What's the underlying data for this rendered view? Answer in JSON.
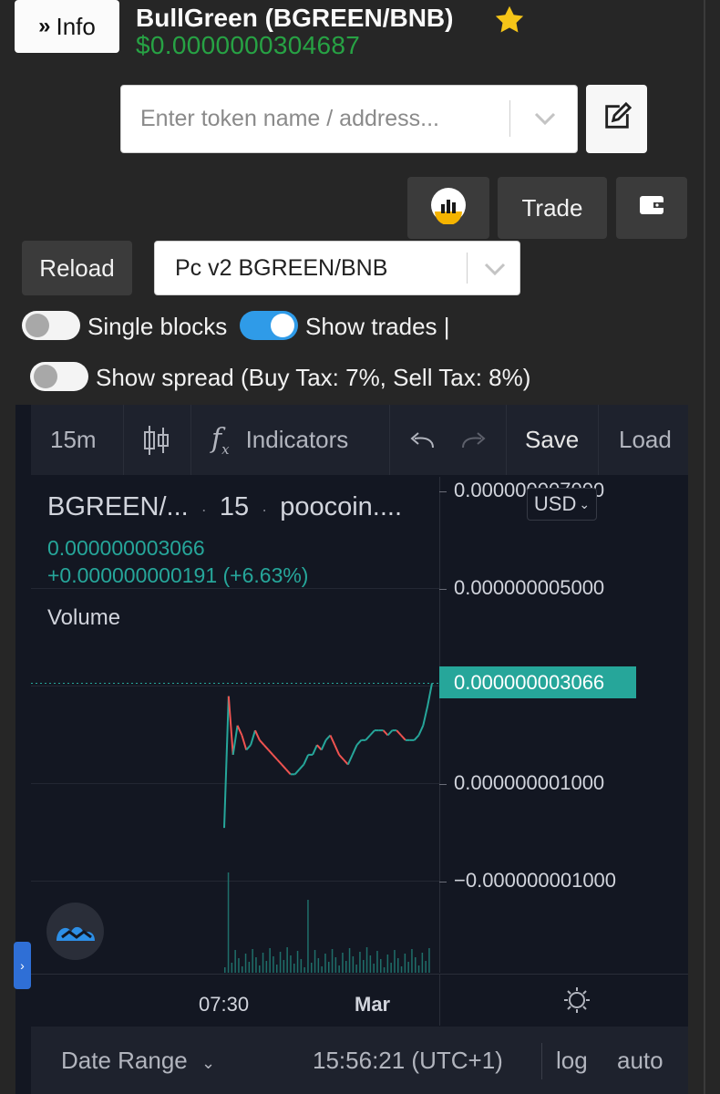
{
  "header": {
    "info_label": "Info",
    "token_title": "BullGreen (BGREEN/BNB)",
    "token_price": "$0.0000000304687"
  },
  "search": {
    "placeholder": "Enter token name / address..."
  },
  "actions": {
    "trade_label": "Trade",
    "reload_label": "Reload"
  },
  "pair_select": {
    "value": "Pc v2 BGREEN/BNB"
  },
  "toggles": {
    "single_blocks": {
      "label": "Single blocks",
      "on": false
    },
    "show_trades": {
      "label": "Show trades |",
      "on": true
    },
    "show_spread": {
      "label": "Show spread (Buy Tax: 7%, Sell Tax: 8%)",
      "on": false
    }
  },
  "chart_toolbar": {
    "interval": "15m",
    "indicators": "Indicators",
    "save": "Save",
    "load": "Load"
  },
  "chart_legend": {
    "symbol": "BGREEN/...",
    "interval": "15",
    "source": "poocoin....",
    "last_value": "0.000000003066",
    "change": "+0.000000000191 (+6.63%)",
    "volume_label": "Volume"
  },
  "price_axis": {
    "currency": "USD",
    "ticks": [
      "0.000000007000",
      "0.000000005000",
      "0.000000001000",
      "−0.000000001000"
    ],
    "current_price": "0.000000003066"
  },
  "time_axis": {
    "ticks": [
      "07:30",
      "Mar"
    ]
  },
  "bottom_bar": {
    "date_range": "Date Range",
    "clock": "15:56:21 (UTC+1)",
    "log": "log",
    "auto": "auto"
  },
  "colors": {
    "price_green": "#27a244",
    "toggle_blue": "#2f9be8",
    "up_candle": "#26a69a",
    "down_candle": "#ef5350",
    "chart_bg": "#131722"
  },
  "chart_data": {
    "type": "line",
    "ylim": [
      -2e-09,
      7e-09
    ],
    "yticks": [
      7e-09,
      5e-09,
      3.066e-09,
      1e-09,
      -1e-09
    ],
    "xticks": [
      "07:30",
      "Mar"
    ],
    "series": [
      {
        "values": [
          1e-10,
          2.8e-09,
          1.6e-09,
          2.2e-09,
          2e-09,
          1.7e-09,
          1.8e-09,
          2.1e-09,
          1.9e-09,
          1.8e-09,
          1.7e-09,
          1.6e-09,
          1.5e-09,
          1.4e-09,
          1.3e-09,
          1.2e-09,
          1.2e-09,
          1.3e-09,
          1.4e-09,
          1.6e-09,
          1.6e-09,
          1.8e-09,
          1.7e-09,
          1.9e-09,
          2e-09,
          1.8e-09,
          1.6e-09,
          1.5e-09,
          1.4e-09,
          1.6e-09,
          1.8e-09,
          1.9e-09,
          1.9e-09,
          2e-09,
          2.1e-09,
          2.1e-09,
          2.1e-09,
          2e-09,
          2.1e-09,
          2.1e-09,
          2e-09,
          1.9e-09,
          1.9e-09,
          1.9e-09,
          2e-09,
          2.2e-09,
          2.6e-09,
          3.066e-09
        ]
      }
    ]
  }
}
